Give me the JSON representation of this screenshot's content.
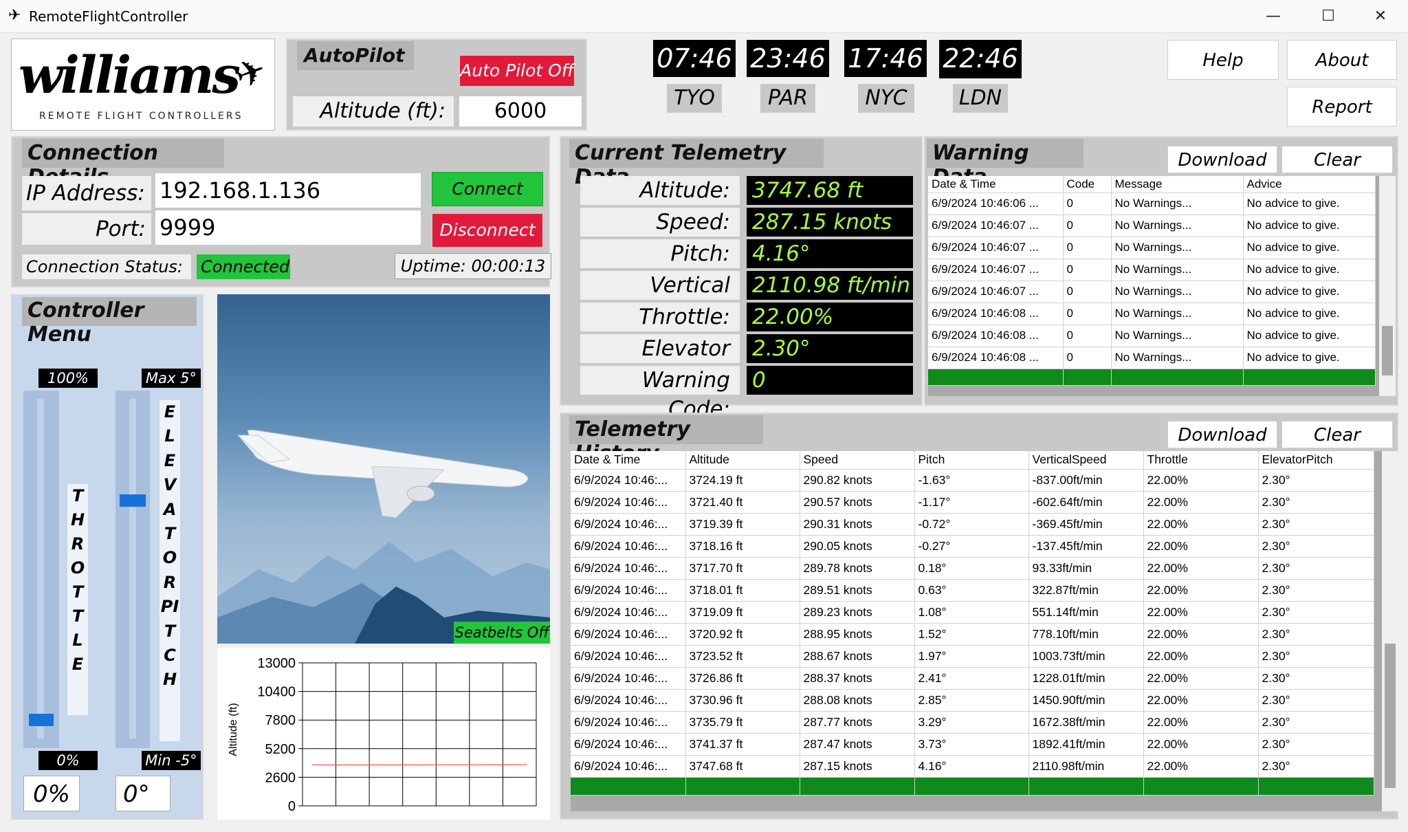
{
  "window": {
    "title": "RemoteFlightController",
    "minimize": "—",
    "maximize": "☐",
    "close": "✕"
  },
  "logo": {
    "brand": "williams",
    "tagline": "REMOTE FLIGHT CONTROLLERS"
  },
  "autopilot": {
    "header": "AutoPilot",
    "button": "Auto Pilot Off",
    "altitude_label": "Altitude (ft):",
    "altitude_value": "6000"
  },
  "clocks": [
    {
      "time": "07:46",
      "city": "TYO"
    },
    {
      "time": "23:46",
      "city": "PAR"
    },
    {
      "time": "17:46",
      "city": "NYC"
    },
    {
      "time": "22:46",
      "city": "LDN"
    }
  ],
  "top_buttons": {
    "help": "Help",
    "about": "About",
    "report": "Report"
  },
  "connection": {
    "header": "Connection Details",
    "ip_label": "IP Address:",
    "ip_value": "192.168.1.136",
    "port_label": "Port:",
    "port_value": "9999",
    "connect": "Connect",
    "disconnect": "Disconnect",
    "status_label": "Connection Status:",
    "status_value": "Connected",
    "uptime": "Uptime: 00:00:13"
  },
  "controller": {
    "header": "Controller Menu",
    "throttle_max": "100%",
    "throttle_min": "0%",
    "throttle_label": "THROTTLE",
    "throttle_value": "0%",
    "throttle_level": 0.05,
    "elevator_max": "Max 5°",
    "elevator_min": "Min -5°",
    "elevator_label": "ELEVATOR PITCH",
    "elevator_value": "0°",
    "elevator_level": 0.5
  },
  "image": {
    "seatbelts": "Seatbelts Off"
  },
  "chart_data": {
    "type": "line",
    "ylabel": "Altitude (ft)",
    "xlabel": "",
    "ylim": [
      0,
      13000
    ],
    "yticks": [
      "13000",
      "10400",
      "7800",
      "5200",
      "2600",
      "0"
    ],
    "grid": true,
    "series": [
      {
        "values": [
          3724,
          3721,
          3719,
          3718,
          3718,
          3718,
          3719,
          3721,
          3724,
          3727,
          3731,
          3736,
          3741,
          3748
        ],
        "color": "#ff4b4b"
      }
    ]
  },
  "telemetry": {
    "header": "Current Telemetry Data",
    "rows": [
      {
        "label": "Altitude:",
        "value": "3747.68 ft"
      },
      {
        "label": "Speed:",
        "value": "287.15 knots"
      },
      {
        "label": "Pitch:",
        "value": "4.16°"
      },
      {
        "label": "Vertical Speed:",
        "value": "2110.98 ft/min"
      },
      {
        "label": "Throttle:",
        "value": "22.00%"
      },
      {
        "label": "Elevator Pitch:",
        "value": "2.30°"
      },
      {
        "label": "Warning Code:",
        "value": "0"
      }
    ]
  },
  "warnings": {
    "header": "Warning Data",
    "download": "Download",
    "clear": "Clear",
    "columns": [
      "Date & Time",
      "Code",
      "Message",
      "Advice"
    ],
    "rows": [
      [
        "6/9/2024 10:46:06 ...",
        "0",
        "No Warnings...",
        "No advice to give."
      ],
      [
        "6/9/2024 10:46:07 ...",
        "0",
        "No Warnings...",
        "No advice to give."
      ],
      [
        "6/9/2024 10:46:07 ...",
        "0",
        "No Warnings...",
        "No advice to give."
      ],
      [
        "6/9/2024 10:46:07 ...",
        "0",
        "No Warnings...",
        "No advice to give."
      ],
      [
        "6/9/2024 10:46:07 ...",
        "0",
        "No Warnings...",
        "No advice to give."
      ],
      [
        "6/9/2024 10:46:08 ...",
        "0",
        "No Warnings...",
        "No advice to give."
      ],
      [
        "6/9/2024 10:46:08 ...",
        "0",
        "No Warnings...",
        "No advice to give."
      ],
      [
        "6/9/2024 10:46:08 ...",
        "0",
        "No Warnings...",
        "No advice to give."
      ]
    ]
  },
  "history": {
    "header": "Telemetry History",
    "download": "Download",
    "clear": "Clear",
    "columns": [
      "Date & Time",
      "Altitude",
      "Speed",
      "Pitch",
      "VerticalSpeed",
      "Throttle",
      "ElevatorPitch"
    ],
    "rows": [
      [
        "6/9/2024 10:46:...",
        "3724.19 ft",
        "290.82 knots",
        "-1.63°",
        "-837.00ft/min",
        "22.00%",
        "2.30°"
      ],
      [
        "6/9/2024 10:46:...",
        "3721.40 ft",
        "290.57 knots",
        "-1.17°",
        "-602.64ft/min",
        "22.00%",
        "2.30°"
      ],
      [
        "6/9/2024 10:46:...",
        "3719.39 ft",
        "290.31 knots",
        "-0.72°",
        "-369.45ft/min",
        "22.00%",
        "2.30°"
      ],
      [
        "6/9/2024 10:46:...",
        "3718.16 ft",
        "290.05 knots",
        "-0.27°",
        "-137.45ft/min",
        "22.00%",
        "2.30°"
      ],
      [
        "6/9/2024 10:46:...",
        "3717.70 ft",
        "289.78 knots",
        "0.18°",
        "93.33ft/min",
        "22.00%",
        "2.30°"
      ],
      [
        "6/9/2024 10:46:...",
        "3718.01 ft",
        "289.51 knots",
        "0.63°",
        "322.87ft/min",
        "22.00%",
        "2.30°"
      ],
      [
        "6/9/2024 10:46:...",
        "3719.09 ft",
        "289.23 knots",
        "1.08°",
        "551.14ft/min",
        "22.00%",
        "2.30°"
      ],
      [
        "6/9/2024 10:46:...",
        "3720.92 ft",
        "288.95 knots",
        "1.52°",
        "778.10ft/min",
        "22.00%",
        "2.30°"
      ],
      [
        "6/9/2024 10:46:...",
        "3723.52 ft",
        "288.67 knots",
        "1.97°",
        "1003.73ft/min",
        "22.00%",
        "2.30°"
      ],
      [
        "6/9/2024 10:46:...",
        "3726.86 ft",
        "288.37 knots",
        "2.41°",
        "1228.01ft/min",
        "22.00%",
        "2.30°"
      ],
      [
        "6/9/2024 10:46:...",
        "3730.96 ft",
        "288.08 knots",
        "2.85°",
        "1450.90ft/min",
        "22.00%",
        "2.30°"
      ],
      [
        "6/9/2024 10:46:...",
        "3735.79 ft",
        "287.77 knots",
        "3.29°",
        "1672.38ft/min",
        "22.00%",
        "2.30°"
      ],
      [
        "6/9/2024 10:46:...",
        "3741.37 ft",
        "287.47 knots",
        "3.73°",
        "1892.41ft/min",
        "22.00%",
        "2.30°"
      ],
      [
        "6/9/2024 10:46:...",
        "3747.68 ft",
        "287.15 knots",
        "4.16°",
        "2110.98ft/min",
        "22.00%",
        "2.30°"
      ]
    ]
  }
}
